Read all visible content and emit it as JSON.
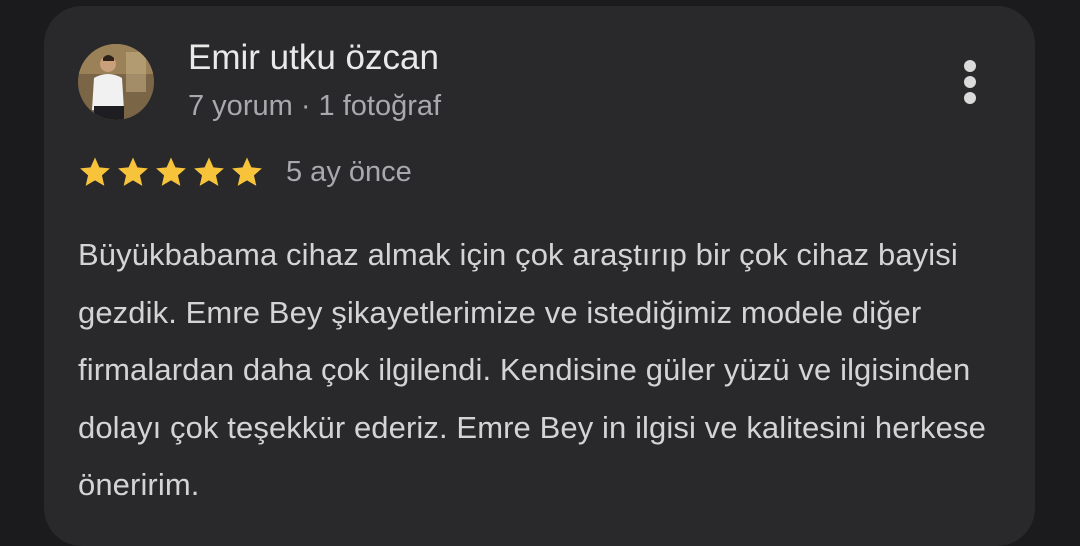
{
  "review": {
    "author_name": "Emir utku özcan",
    "author_meta": "7 yorum · 1 fotoğraf",
    "rating": 5,
    "rating_max": 5,
    "time_ago": "5 ay önce",
    "text": "Büyükbabama cihaz almak için çok araştırıp bir çok cihaz bayisi gezdik. Emre Bey şikayetlerimize ve istediğimiz modele diğer firmalardan daha çok ilgilendi. Kendisine güler yüzü ve ilgisinden dolayı çok teşekkür ederiz. Emre Bey in ilgisi ve kalitesini herkese öneririm."
  },
  "icons": {
    "more": "more-vert-icon",
    "star": "star-icon"
  },
  "colors": {
    "background": "#1b1b1d",
    "card": "#29292b",
    "star": "#f7c33b",
    "primary_text": "#e9e9ea",
    "secondary_text": "#a9a9ad"
  }
}
